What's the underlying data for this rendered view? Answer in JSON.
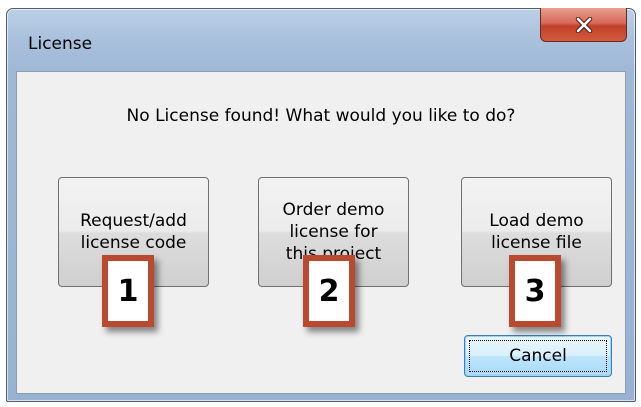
{
  "window": {
    "title": "License",
    "close_icon": "close-x-icon"
  },
  "dialog": {
    "message": "No License found! What would you like to do?",
    "options": [
      {
        "label": "Request/add\nlicense code"
      },
      {
        "label": "Order demo\nlicense for\nthis project"
      },
      {
        "label": "Load demo\nlicense file"
      }
    ],
    "cancel_label": "Cancel"
  },
  "callouts": [
    "1",
    "2",
    "3"
  ],
  "colors": {
    "callout_border": "#b94a2f",
    "close_button": "#c2402b",
    "frame": "#a9c1dc"
  }
}
